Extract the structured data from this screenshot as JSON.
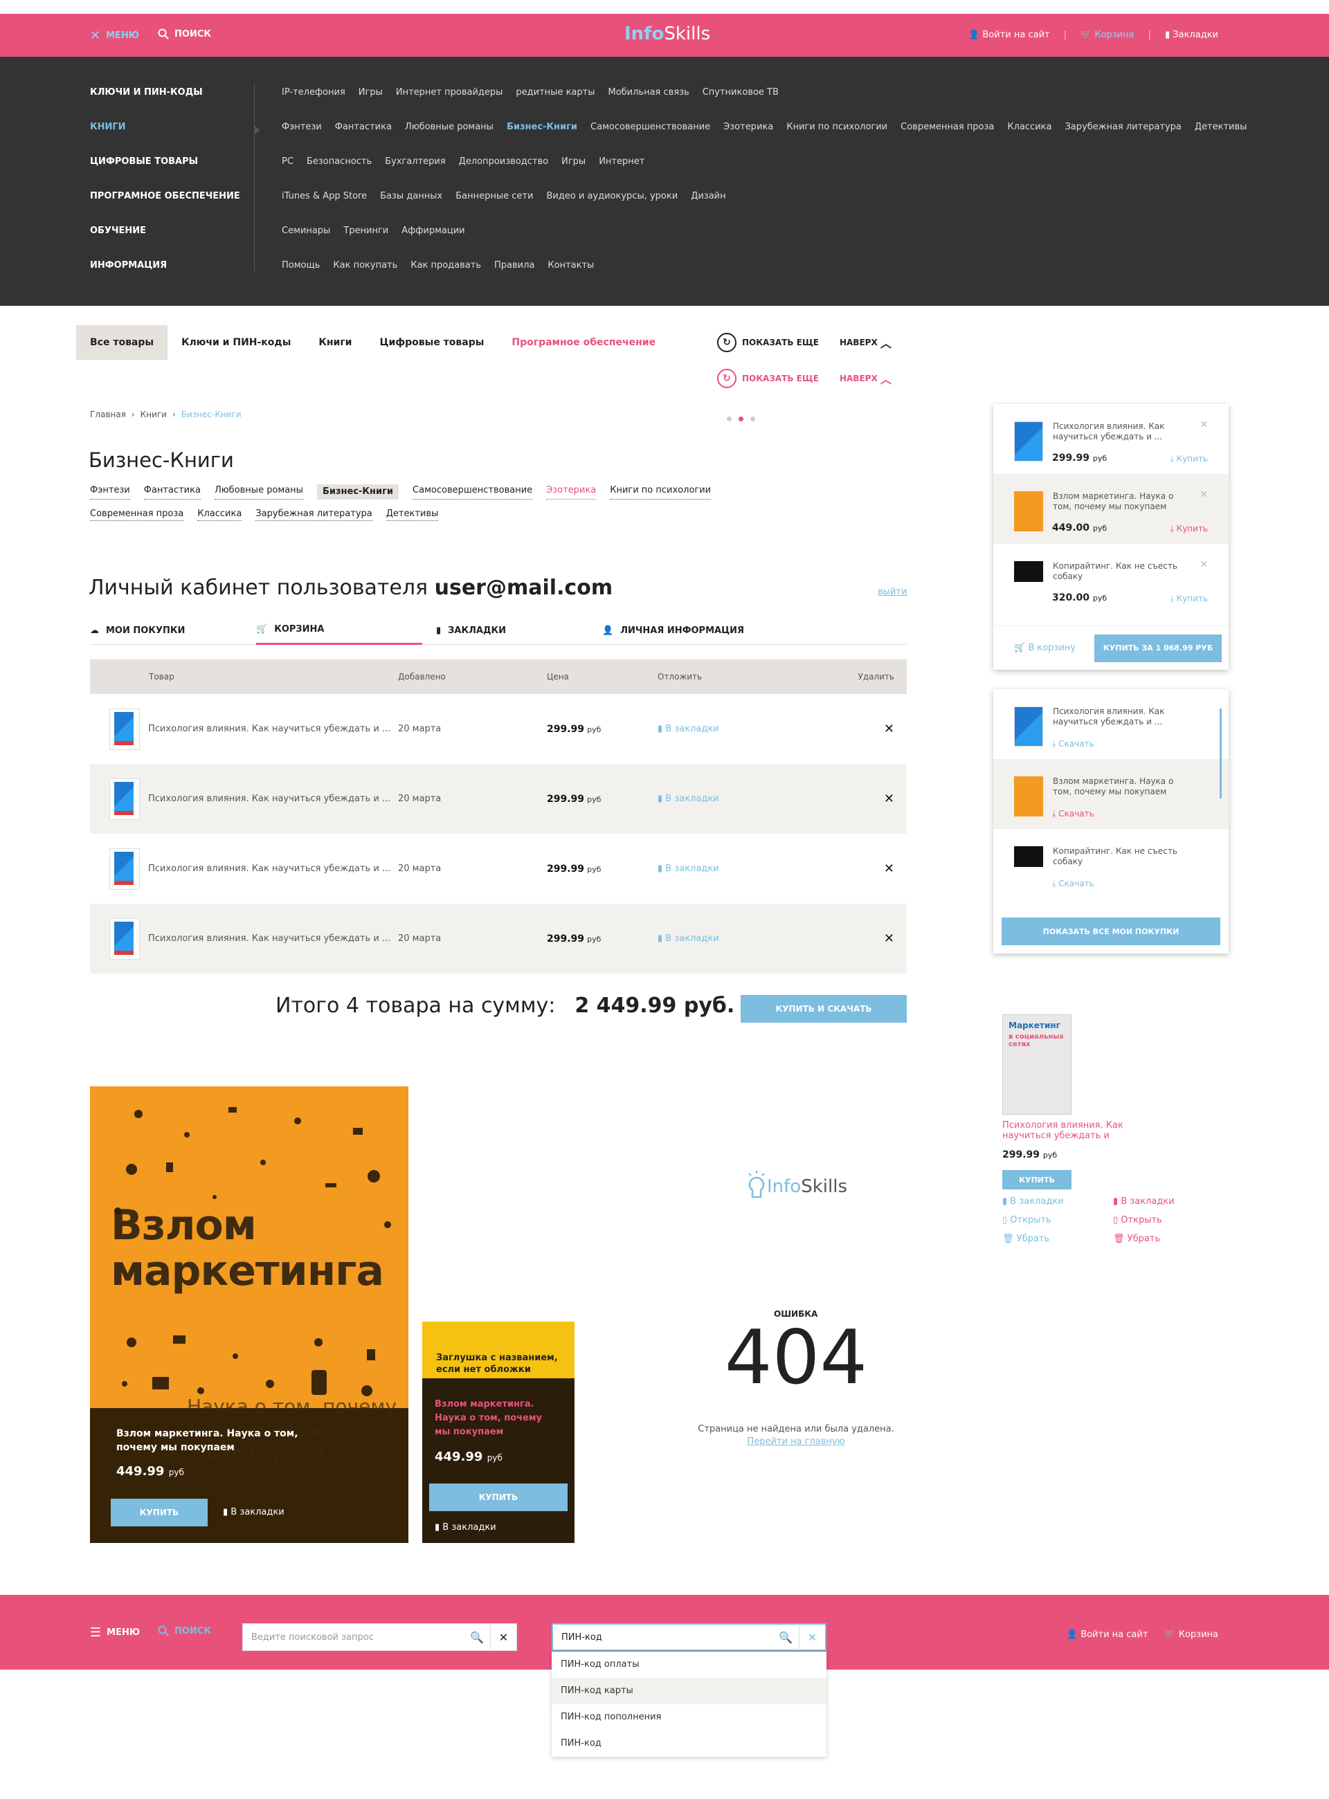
{
  "header": {
    "menu_label": "МЕНЮ",
    "search_label": "ПОИСК",
    "logo_info": "Info",
    "logo_skills": "Skills",
    "login": "Войти на сайт",
    "cart": "Корзина",
    "bookmarks": "Закладки"
  },
  "menu": {
    "categories": [
      "Ключи и ПИН-коды",
      "Книги",
      "Цифровые товары",
      "Програмное обеспечение",
      "Обучение",
      "Информация"
    ],
    "subrows": [
      [
        "IP-телефония",
        "Игры",
        "Интернет провайдеры",
        "редитные карты",
        "Мобильная связь",
        "Спутниковое ТВ"
      ],
      [
        "Фэнтези",
        "Фантастика",
        "Любовные романы",
        "Бизнес-Книги",
        "Самосовершенствование",
        "Эзотерика",
        "Книги по психологии",
        "Современная проза",
        "Классика",
        "Зарубежная литература",
        "Детективы"
      ],
      [
        "PC",
        "Безопасность",
        "Бухгалтерия",
        "Делопроизводство",
        "Игры",
        "Интернет"
      ],
      [
        "iTunes & App Store",
        "Базы данных",
        "Баннерные сети",
        "Видео и аудиокурсы, уроки",
        "Дизайн"
      ],
      [
        "Семинары",
        "Тренинги",
        "Аффирмации"
      ],
      [
        "Помощь",
        "Как покупать",
        "Как продавать",
        "Правила",
        "Контакты"
      ]
    ]
  },
  "filters": [
    "Все товары",
    "Ключи и ПИН-коды",
    "Книги",
    "Цифровые товары",
    "Програмное обеспечение"
  ],
  "more": {
    "show_more": "ПОКАЗАТЬ ЕЩЕ",
    "up": "НАВЕРХ"
  },
  "breadcrumb": [
    "Главная",
    "Книги",
    "Бизнес-Книги"
  ],
  "page_title": "Бизнес-Книги",
  "subcats": [
    "Фэнтези",
    "Фантастика",
    "Любовные романы",
    "Бизнес-Книги",
    "Самосовершенствование",
    "Эзотерика",
    "Книги по психологии",
    "Современная проза",
    "Классика",
    "Зарубежная литература",
    "Детективы"
  ],
  "cabinet": {
    "title_prefix": "Личный кабинет пользователя",
    "email": "user@mail.com",
    "logout": "выйти",
    "tabs": [
      "МОИ ПОКУПКИ",
      "КОРЗИНА",
      "ЗАКЛАДКИ",
      "ЛИЧНАЯ ИНФОРМАЦИЯ"
    ],
    "columns": [
      "Товар",
      "Добавлено",
      "Цена",
      "Отложить",
      "Удалить"
    ],
    "rows": [
      {
        "name": "Психология влияния. Как научиться убеждать и ...",
        "added": "20 марта",
        "price": "299.99",
        "currency": "руб",
        "bookmark": "В закладки"
      },
      {
        "name": "Психология влияния. Как научиться убеждать и ...",
        "added": "20 марта",
        "price": "299.99",
        "currency": "руб",
        "bookmark": "В закладки"
      },
      {
        "name": "Психология влияния. Как научиться убеждать и ...",
        "added": "20 марта",
        "price": "299.99",
        "currency": "руб",
        "bookmark": "В закладки"
      },
      {
        "name": "Психология влияния. Как научиться убеждать и ...",
        "added": "20 марта",
        "price": "299.99",
        "currency": "руб",
        "bookmark": "В закладки"
      }
    ],
    "total_label": "Итого 4 товара на сумму:",
    "total_value": "2 449.99 руб.",
    "buy_download": "КУПИТЬ И СКАЧАТЬ"
  },
  "cart_dropdown": {
    "items": [
      {
        "name": "Психология влияния. Как научиться убеждать и ...",
        "price": "299.99",
        "currency": "руб",
        "action": "Купить"
      },
      {
        "name": "Взлом маркетинга. Наука о том, почему мы покупаем",
        "price": "449.00",
        "currency": "руб",
        "action": "Купить"
      },
      {
        "name": "Копирайтинг. Как не съесть собаку",
        "price": "320.00",
        "currency": "руб",
        "action": "Купить"
      }
    ],
    "to_cart": "В корзину",
    "buy_for": "КУПИТЬ ЗА 1 068.99 РУБ"
  },
  "purchases_dropdown": {
    "items": [
      {
        "name": "Психология влияния. Как научиться убеждать и ...",
        "action": "Скачать"
      },
      {
        "name": "Взлом маркетинга. Наука о том, почему мы покупаем",
        "action": "Скачать"
      },
      {
        "name": "Копирайтинг. Как не съесть собаку",
        "action": "Скачать"
      }
    ],
    "show_all": "ПОКАЗАТЬ ВСЕ МОИ ПОКУПКИ"
  },
  "product_card": {
    "cover_title": "Маркетинг",
    "cover_subtitle": "в социальных сетях",
    "name": "Психология влияния. Как научиться убеждать и",
    "price": "299.99",
    "currency": "руб",
    "buy": "КУПИТЬ",
    "bookmark": "В закладки",
    "open": "Открыть",
    "remove": "Убрать"
  },
  "big_card": {
    "cover_big": "Взлом маркетинга",
    "cover_sub": "Наука о том, почему мы покупаем",
    "cover_author": "Фил Барден",
    "title": "Взлом маркетинга. Наука о том, почему мы покупаем",
    "price": "449.99",
    "currency": "руб",
    "buy": "КУПИТЬ",
    "bookmark": "В закладки"
  },
  "stub_card": {
    "top": "Заглушка с названием, если нет обложки",
    "title": "Взлом маркетинга. Наука о том, почему мы покупаем",
    "price": "449.99",
    "currency": "руб",
    "buy": "КУПИТЬ",
    "bookmark": "В закладки"
  },
  "error_page": {
    "label": "ОШИБКА",
    "code": "404",
    "message": "Страница не найдена или была удалена.",
    "link": "Перейти на главную"
  },
  "footer_bar": {
    "menu": "МЕНЮ",
    "search": "ПОИСК",
    "placeholder": "Ведите поисковой запрос",
    "query": "ПИН-код",
    "login": "Войти на сайт",
    "cart": "Корзина"
  },
  "suggestions": [
    "ПИН-код оплаты",
    "ПИН-код карты",
    "ПИН-код пополнения",
    "ПИН-код"
  ],
  "colors": {
    "accent": "#e8527a",
    "blue": "#7cbde0",
    "dark": "#333333",
    "beige": "#e5e1dc"
  }
}
